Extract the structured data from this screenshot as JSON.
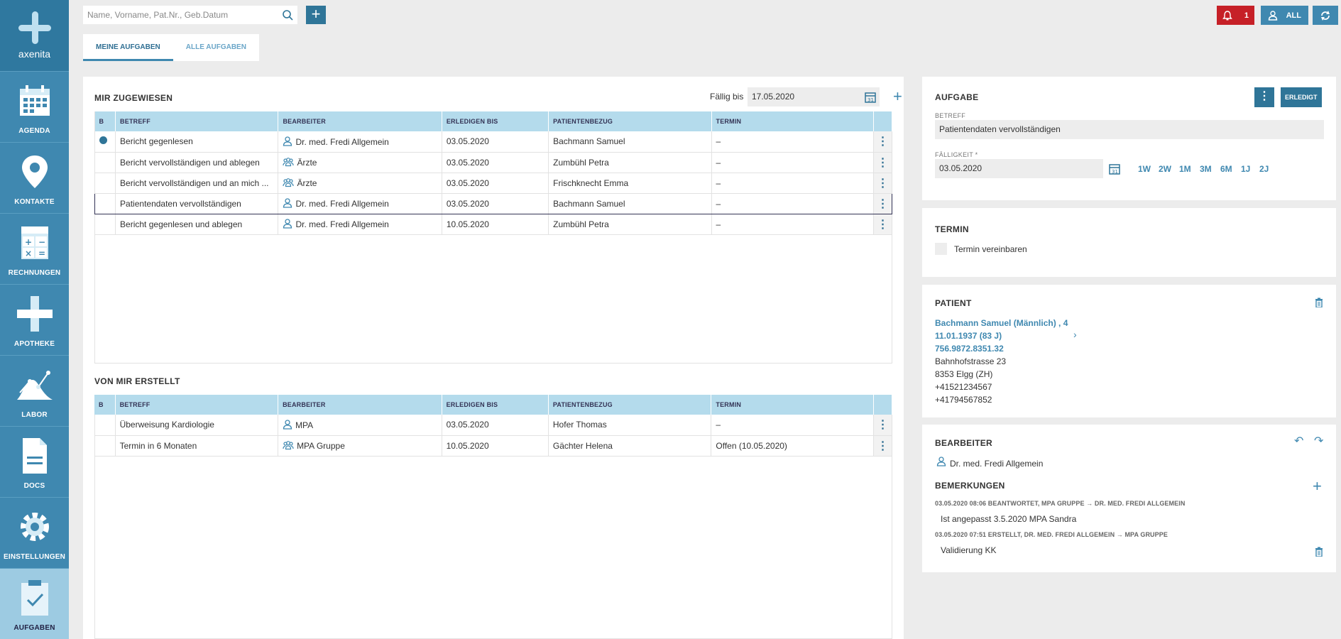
{
  "app": {
    "name": "axenita"
  },
  "nav": [
    {
      "label": "AGENDA",
      "icon": "calendar-icon"
    },
    {
      "label": "KONTAKTE",
      "icon": "location-pin-icon"
    },
    {
      "label": "RECHNUNGEN",
      "icon": "calculator-icon"
    },
    {
      "label": "APOTHEKE",
      "icon": "cross-icon"
    },
    {
      "label": "LABOR",
      "icon": "lab-chart-icon"
    },
    {
      "label": "DOCS",
      "icon": "document-icon"
    },
    {
      "label": "EINSTELLUNGEN",
      "icon": "gear-icon"
    },
    {
      "label": "AUFGABEN",
      "icon": "clipboard-check-icon",
      "active": true
    }
  ],
  "search": {
    "placeholder": "Name, Vorname, Pat.Nr., Geb.Datum"
  },
  "top": {
    "notif_count": "1",
    "all_label": "ALL"
  },
  "tabs": [
    {
      "label": "MEINE AUFGABEN",
      "active": true
    },
    {
      "label": "ALLE AUFGABEN",
      "active": false
    }
  ],
  "assigned": {
    "title": "MIR ZUGEWIESEN",
    "due_label": "Fällig bis",
    "due_value": "17.05.2020",
    "columns": [
      "B",
      "BETREFF",
      "BEARBEITER",
      "ERLEDIGEN BIS",
      "PATIENTENBEZUG",
      "TERMIN"
    ],
    "rows": [
      {
        "dot": true,
        "betreff": "Bericht gegenlesen",
        "bearbeiter": "Dr. med. Fredi Allgemein",
        "group": false,
        "bis": "03.05.2020",
        "patient": "Bachmann Samuel",
        "termin": "–"
      },
      {
        "dot": false,
        "betreff": "Bericht vervollständigen und ablegen",
        "bearbeiter": "Ärzte",
        "group": true,
        "bis": "03.05.2020",
        "patient": "Zumbühl Petra",
        "termin": "–"
      },
      {
        "dot": false,
        "betreff": "Bericht vervollständigen und an mich ...",
        "bearbeiter": "Ärzte",
        "group": true,
        "bis": "03.05.2020",
        "patient": "Frischknecht Emma",
        "termin": "–"
      },
      {
        "dot": false,
        "betreff": "Patientendaten vervollständigen",
        "bearbeiter": "Dr. med. Fredi Allgemein",
        "group": false,
        "bis": "03.05.2020",
        "patient": "Bachmann Samuel",
        "termin": "–",
        "selected": true
      },
      {
        "dot": false,
        "betreff": "Bericht gegenlesen und ablegen",
        "bearbeiter": "Dr. med. Fredi Allgemein",
        "group": false,
        "bis": "10.05.2020",
        "patient": "Zumbühl Petra",
        "termin": "–"
      }
    ]
  },
  "created": {
    "title": "VON MIR ERSTELLT",
    "columns": [
      "B",
      "BETREFF",
      "BEARBEITER",
      "ERLEDIGEN BIS",
      "PATIENTENBEZUG",
      "TERMIN"
    ],
    "rows": [
      {
        "dot": false,
        "betreff": "Überweisung Kardiologie",
        "bearbeiter": "MPA",
        "group": false,
        "bis": "03.05.2020",
        "patient": "Hofer Thomas",
        "termin": "–"
      },
      {
        "dot": false,
        "betreff": "Termin in 6 Monaten",
        "bearbeiter": "MPA Gruppe",
        "group": true,
        "bis": "10.05.2020",
        "patient": "Gächter Helena",
        "termin": "Offen (10.05.2020)"
      }
    ]
  },
  "task": {
    "title": "AUFGABE",
    "done_label": "ERLEDIGT",
    "betreff_label": "BETREFF",
    "betreff_value": "Patientendaten vervollständigen",
    "due_label": "FÄLLIGKEIT *",
    "due_value": "03.05.2020",
    "quick": [
      "1W",
      "2W",
      "1M",
      "3M",
      "6M",
      "1J",
      "2J"
    ]
  },
  "termin": {
    "title": "TERMIN",
    "checkbox_label": "Termin vereinbaren"
  },
  "patient": {
    "title": "PATIENT",
    "name": "Bachmann Samuel (Männlich) , 4",
    "birth": "11.01.1937 (83 J)",
    "ahv": "756.9872.8351.32",
    "street": "Bahnhofstrasse 23",
    "city": "8353 Elgg (ZH)",
    "phone1": "+41521234567",
    "phone2": "+41794567852"
  },
  "bearbeiter": {
    "title": "BEARBEITER",
    "name": "Dr. med. Fredi Allgemein",
    "remarks_title": "BEMERKUNGEN",
    "remarks": [
      {
        "meta": "03.05.2020 08:06 BEANTWORTET, MPA GRUPPE → DR. MED. FREDI ALLGEMEIN",
        "text": "Ist angepasst 3.5.2020 MPA Sandra"
      },
      {
        "meta": "03.05.2020 07:51 ERSTELLT, DR. MED. FREDI ALLGEMEIN → MPA GRUPPE",
        "text": "Validierung KK"
      }
    ]
  },
  "colors": {
    "accent": "#3f88b0",
    "accent_dark": "#2f7598",
    "danger": "#c62027",
    "header": "#b4dbec"
  }
}
